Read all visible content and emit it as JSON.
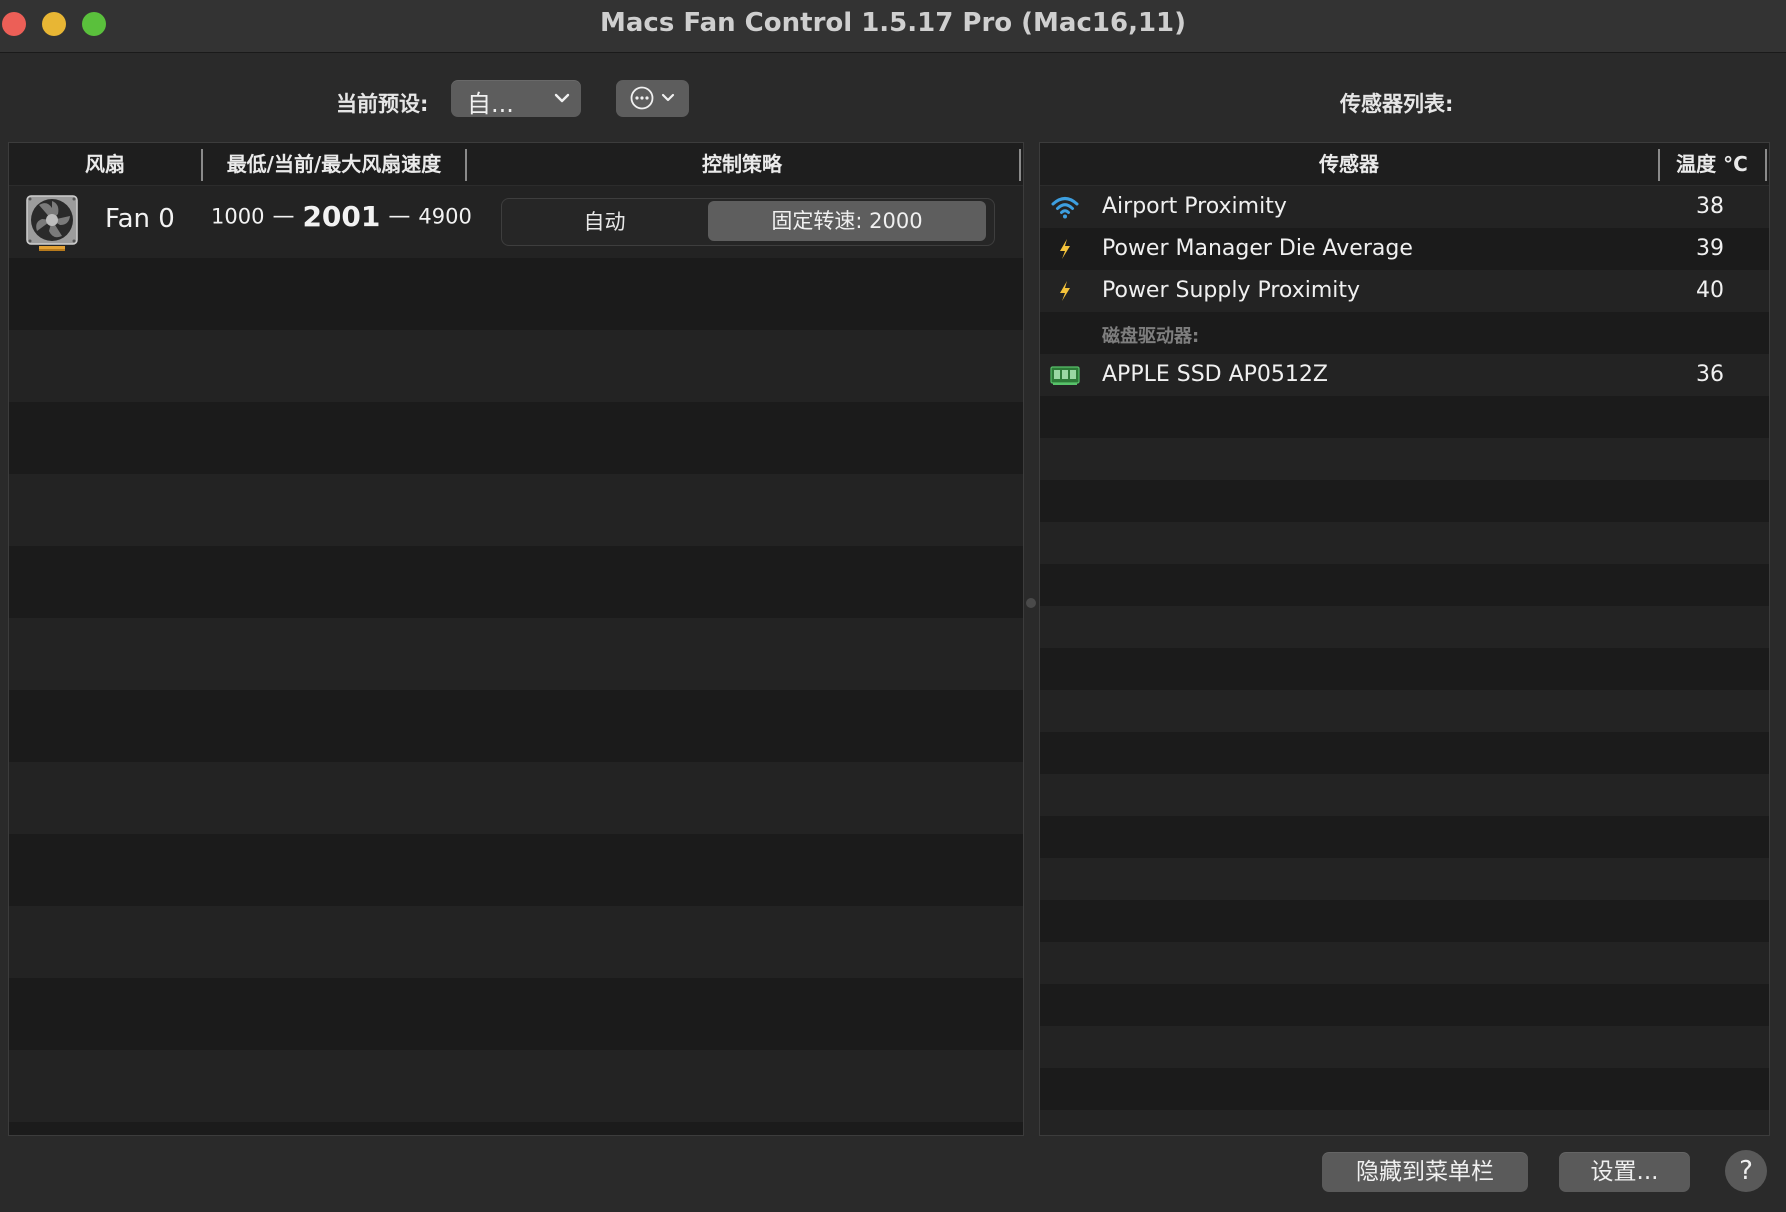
{
  "window": {
    "title": "Macs Fan Control 1.5.17 Pro (Mac16,11)"
  },
  "toolbar": {
    "preset_label": "当前预设:",
    "preset_value": "自...",
    "sensor_list_label": "传感器列表:"
  },
  "fan_table": {
    "headers": {
      "fan": "风扇",
      "speed": "最低/当前/最大风扇速度",
      "control": "控制策略"
    },
    "rows": [
      {
        "name": "Fan 0",
        "min": "1000",
        "dash1": "—",
        "current": "2001",
        "dash2": "—",
        "max": "4900",
        "mode_auto": "自动",
        "mode_fixed": "固定转速: 2000",
        "selected_mode": "fixed"
      }
    ]
  },
  "sensor_table": {
    "headers": {
      "sensor": "传感器",
      "temp": "温度 °C"
    },
    "rows": [
      {
        "kind": "sensor",
        "icon": "wifi-icon",
        "name": "Airport Proximity",
        "value": "38"
      },
      {
        "kind": "sensor",
        "icon": "lightning-icon",
        "name": "Power Manager Die Average",
        "value": "39"
      },
      {
        "kind": "sensor",
        "icon": "lightning-icon",
        "name": "Power Supply Proximity",
        "value": "40"
      },
      {
        "kind": "group",
        "name": "磁盘驱动器:"
      },
      {
        "kind": "sensor",
        "icon": "ssd-icon",
        "name": "APPLE SSD AP0512Z",
        "value": "36"
      }
    ]
  },
  "footer": {
    "hide_button": "隐藏到菜单栏",
    "settings_button": "设置...",
    "help_button": "?"
  },
  "colors": {
    "wifi_icon": "#3d9fe0",
    "lightning_icon": "#f5c33b",
    "ssd_icon": "#3aa14a"
  }
}
